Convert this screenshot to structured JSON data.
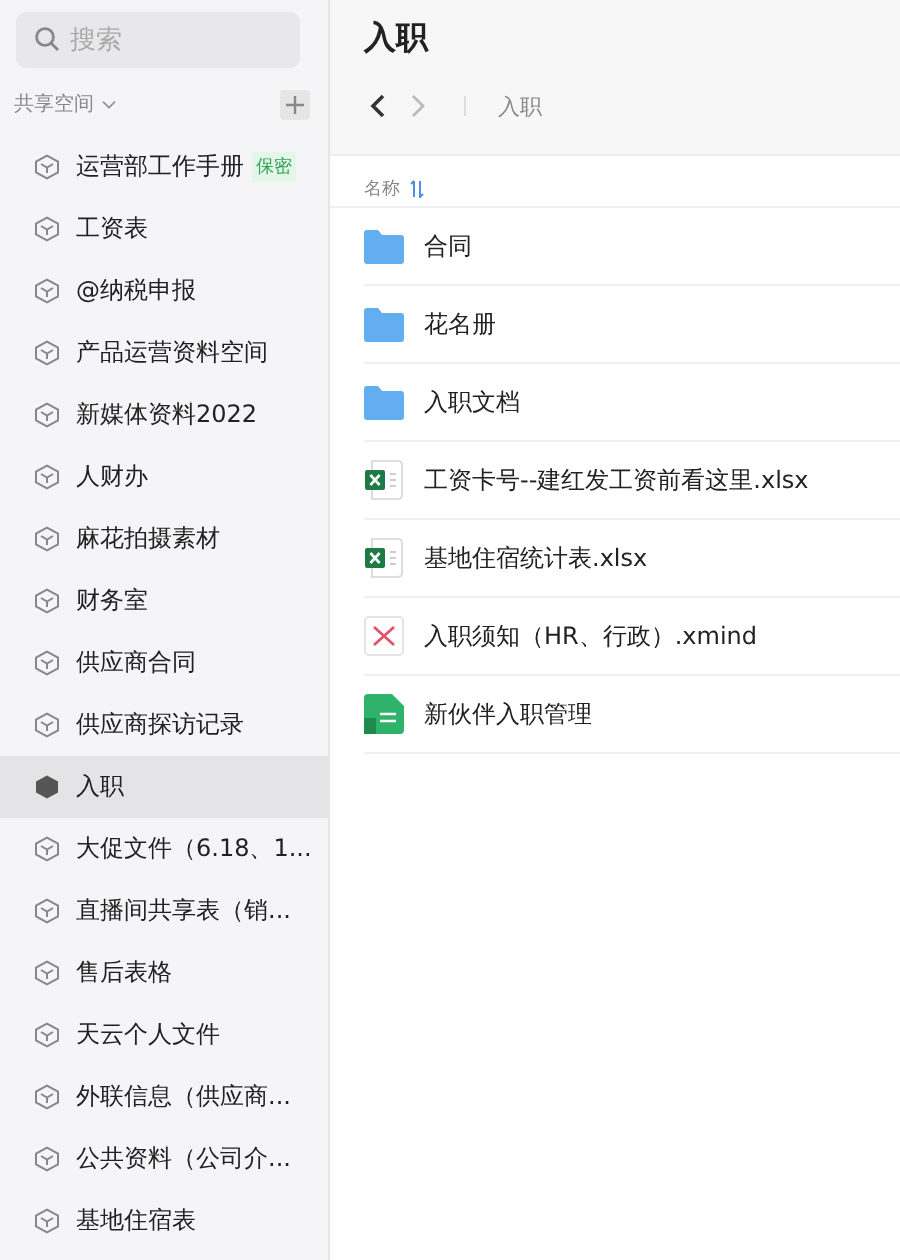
{
  "sidebar": {
    "search": {
      "placeholder": "搜索"
    },
    "section": {
      "label": "共享空间"
    },
    "items": [
      {
        "label": "运营部工作手册",
        "badge": "保密",
        "selected": false
      },
      {
        "label": "工资表",
        "selected": false
      },
      {
        "label": "@纳税申报",
        "selected": false
      },
      {
        "label": "产品运营资料空间",
        "selected": false
      },
      {
        "label": "新媒体资料2022",
        "selected": false
      },
      {
        "label": "人财办",
        "selected": false
      },
      {
        "label": "麻花拍摄素材",
        "selected": false
      },
      {
        "label": "财务室",
        "selected": false
      },
      {
        "label": "供应商合同",
        "selected": false
      },
      {
        "label": "供应商探访记录",
        "selected": false
      },
      {
        "label": "入职",
        "selected": true
      },
      {
        "label": "大促文件（6.18、1...",
        "selected": false
      },
      {
        "label": "直播间共享表（销...",
        "selected": false
      },
      {
        "label": "售后表格",
        "selected": false
      },
      {
        "label": "天云个人文件",
        "selected": false
      },
      {
        "label": "外联信息（供应商...",
        "selected": false
      },
      {
        "label": "公共资料（公司介...",
        "selected": false
      },
      {
        "label": "基地住宿表",
        "selected": false
      }
    ]
  },
  "main": {
    "title": "入职",
    "breadcrumb": "入职",
    "column": "名称",
    "files": [
      {
        "name": "合同",
        "kind": "folder"
      },
      {
        "name": "花名册",
        "kind": "folder"
      },
      {
        "name": "入职文档",
        "kind": "folder"
      },
      {
        "name": "工资卡号--建红发工资前看这里.xlsx",
        "kind": "excel"
      },
      {
        "name": "基地住宿统计表.xlsx",
        "kind": "excel"
      },
      {
        "name": "入职须知（HR、行政）.xmind",
        "kind": "xmind"
      },
      {
        "name": "新伙伴入职管理",
        "kind": "sheet"
      }
    ]
  }
}
